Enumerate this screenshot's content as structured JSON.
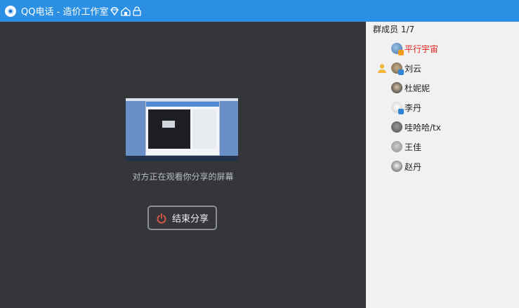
{
  "titlebar": {
    "app_name": "QQ电话",
    "separator": "-",
    "group_name": "造价工作室"
  },
  "main": {
    "status_text": "对方正在观看你分享的屏幕",
    "end_share_label": "结束分享"
  },
  "sidebar": {
    "member_count_label": "群成员 1/7",
    "members": [
      {
        "name": "平行宇宙",
        "highlight": true
      },
      {
        "name": "刘云",
        "host": true
      },
      {
        "name": "杜妮妮"
      },
      {
        "name": "李丹"
      },
      {
        "name": "哇哈哈/tx"
      },
      {
        "name": "王佳"
      },
      {
        "name": "赵丹"
      }
    ]
  },
  "colors": {
    "titlebar": "#2b8fe3",
    "main_bg": "#34363a",
    "sidebar_bg": "#f1f1f1",
    "highlight_name": "#e0201b"
  }
}
